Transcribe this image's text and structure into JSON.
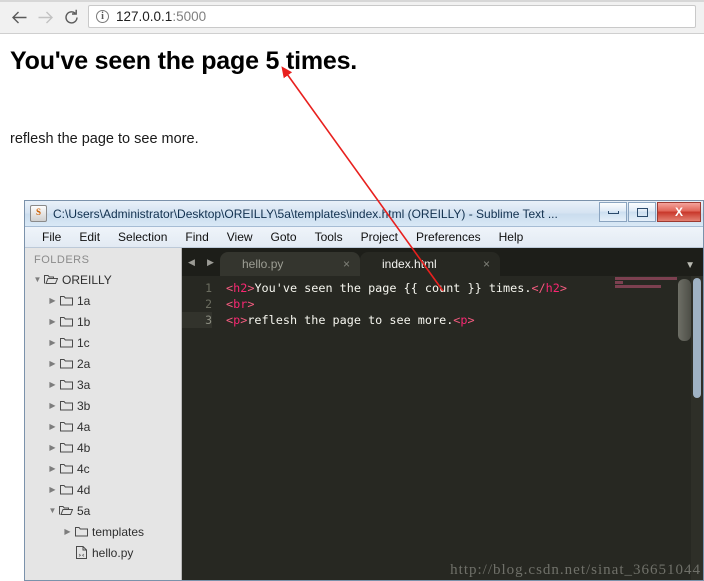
{
  "browser": {
    "back_icon": "arrow-left-icon",
    "forward_icon": "arrow-right-icon",
    "reload_icon": "reload-icon",
    "site_info_icon": "info-circle-icon",
    "url_host": "127.0.0.1",
    "url_port": ":5000",
    "url_full": "127.0.0.1:5000"
  },
  "page": {
    "heading": "You've seen the page 5 times.",
    "count": "5",
    "paragraph": "reflesh the page to see more."
  },
  "sublime": {
    "app_icon": "sublime-text-icon",
    "title": "C:\\Users\\Administrator\\Desktop\\OREILLY\\5a\\templates\\index.html (OREILLY) - Sublime Text ...",
    "window_controls": {
      "minimize": "minimize-icon",
      "maximize": "maximize-icon",
      "close": "X"
    },
    "menu": [
      {
        "label": "File"
      },
      {
        "label": "Edit"
      },
      {
        "label": "Selection"
      },
      {
        "label": "Find"
      },
      {
        "label": "View"
      },
      {
        "label": "Goto"
      },
      {
        "label": "Tools"
      },
      {
        "label": "Project"
      },
      {
        "label": "Preferences"
      },
      {
        "label": "Help"
      }
    ],
    "sidebar": {
      "header": "FOLDERS",
      "tree": [
        {
          "label": "OREILLY",
          "level": 0,
          "type": "folder-open",
          "expanded": true
        },
        {
          "label": "1a",
          "level": 1,
          "type": "folder",
          "expanded": false
        },
        {
          "label": "1b",
          "level": 1,
          "type": "folder",
          "expanded": false
        },
        {
          "label": "1c",
          "level": 1,
          "type": "folder",
          "expanded": false
        },
        {
          "label": "2a",
          "level": 1,
          "type": "folder",
          "expanded": false
        },
        {
          "label": "3a",
          "level": 1,
          "type": "folder",
          "expanded": false
        },
        {
          "label": "3b",
          "level": 1,
          "type": "folder",
          "expanded": false
        },
        {
          "label": "4a",
          "level": 1,
          "type": "folder",
          "expanded": false
        },
        {
          "label": "4b",
          "level": 1,
          "type": "folder",
          "expanded": false
        },
        {
          "label": "4c",
          "level": 1,
          "type": "folder",
          "expanded": false
        },
        {
          "label": "4d",
          "level": 1,
          "type": "folder",
          "expanded": false
        },
        {
          "label": "5a",
          "level": 1,
          "type": "folder-open",
          "expanded": true
        },
        {
          "label": "templates",
          "level": 2,
          "type": "folder",
          "expanded": false
        },
        {
          "label": "hello.py",
          "level": 2,
          "type": "file",
          "expanded": null
        }
      ]
    },
    "tabs": [
      {
        "label": "hello.py",
        "active": false,
        "close": "×"
      },
      {
        "label": "index.html",
        "active": true,
        "close": "×"
      }
    ],
    "tab_nav": {
      "prev": "◀",
      "next": "▶",
      "overflow_menu": "▼"
    },
    "editor": {
      "line_numbers": [
        "1",
        "2",
        "3"
      ],
      "current_line": "3",
      "lines": [
        {
          "n": "1",
          "open_lt": "<",
          "open_tag": "h2",
          "open_gt": ">",
          "text": "You've seen the page {{ count }} times.",
          "close_lt": "</",
          "close_tag": "h2",
          "close_gt": ">"
        },
        {
          "n": "2",
          "open_lt": "<",
          "open_tag": "br",
          "open_gt": ">",
          "text": "",
          "close_lt": "",
          "close_tag": "",
          "close_gt": ""
        },
        {
          "n": "3",
          "open_lt": "<",
          "open_tag": "p",
          "open_gt": ">",
          "text": "reflesh the page to see more.",
          "close_lt": "<",
          "close_tag": "p",
          "close_gt": ">"
        }
      ]
    }
  },
  "watermark": "http://blog.csdn.net/sinat_36651044",
  "annotation": {
    "type": "arrow",
    "color": "#e8201e",
    "from": "{{ count }} in index.html source",
    "to": "the number 5 in the rendered heading"
  },
  "colors": {
    "editor_bg": "#272822",
    "tab_bar_bg": "#1d1e19",
    "sidebar_bg": "#e5e5e5",
    "tag_name": "#f92672",
    "code_text": "#f6f6ef",
    "annotation_red": "#e8201e",
    "titlebar_blue": "#d5e3f2"
  }
}
